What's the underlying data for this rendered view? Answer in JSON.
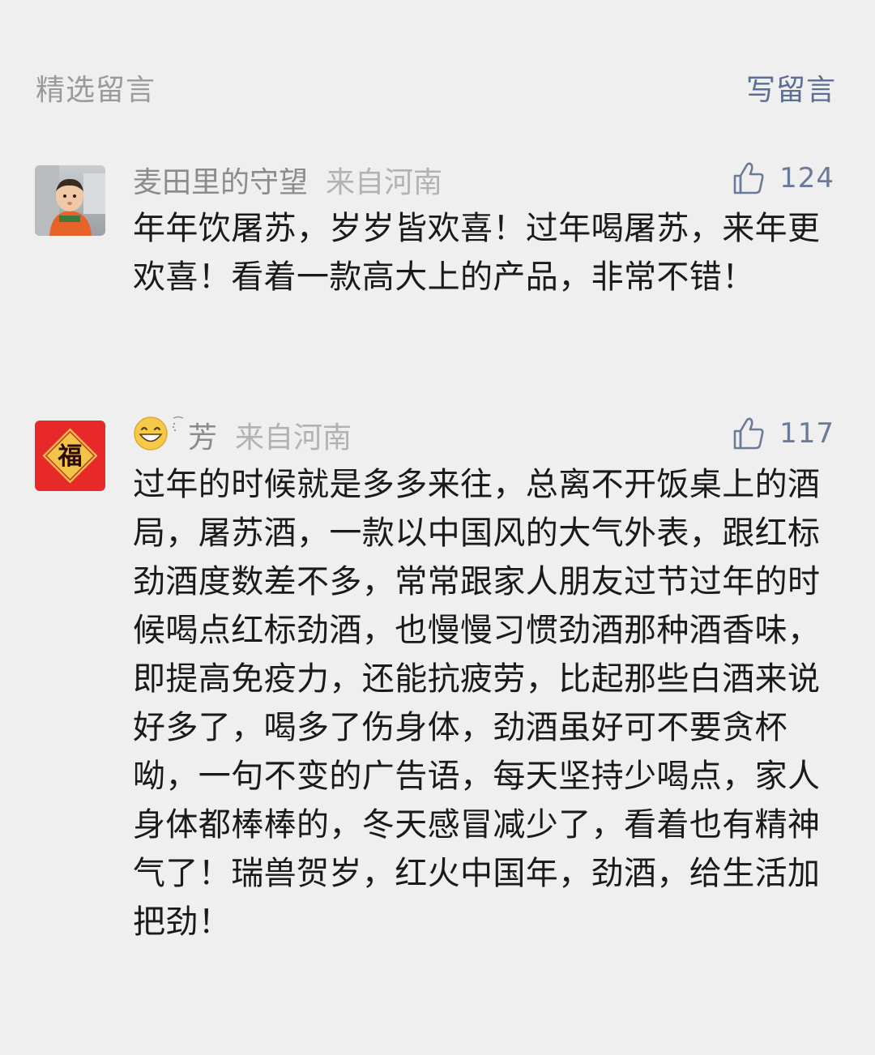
{
  "header": {
    "title": "精选留言",
    "write_label": "写留言"
  },
  "comments": [
    {
      "author": "麦田里的守望",
      "location": "来自河南",
      "likes": "124",
      "content": "年年饮屠苏，岁岁皆欢喜！过年喝屠苏，来年更欢喜！看着一款高大上的产品，非常不错！",
      "avatar_icon": "baby-photo-avatar"
    },
    {
      "author": "芳",
      "location": "来自河南",
      "likes": "117",
      "content": "过年的时候就是多多来往，总离不开饭桌上的酒局，屠苏酒，一款以中国风的大气外表，跟红标劲酒度数差不多，常常跟家人朋友过节过年的时候喝点红标劲酒，也慢慢习惯劲酒那种酒香味，即提高免疫力，还能抗疲劳，比起那些白酒来说好多了，喝多了伤身体，劲酒虽好可不要贪杯呦，一句不变的广告语，每天坚持少喝点，家人身体都棒棒的，冬天感冒减少了，看着也有精神气了！瑞兽贺岁，红火中国年，劲酒，给生活加把劲！",
      "avatar_text": "福",
      "avatar_icon": "fu-character-avatar",
      "name_icons": [
        "grinning-face-icon",
        "sparkle-icon"
      ]
    }
  ],
  "colors": {
    "background": "#efefef",
    "link": "#5c6f93",
    "muted": "#9a9a9a",
    "avatar_red": "#e8292a",
    "fu_gold": "#f3c44a"
  }
}
